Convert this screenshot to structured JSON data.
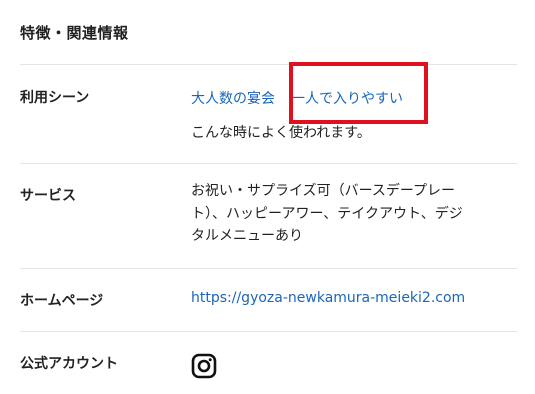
{
  "section": {
    "title": "特徴・関連情報"
  },
  "rows": {
    "scene": {
      "label": "利用シーン",
      "links": [
        "大人数の宴会",
        "一人で入りやすい"
      ],
      "note": "こんな時によく使われます。"
    },
    "service": {
      "label": "サービス",
      "lines": [
        "お祝い・サプライズ可（バースデープレー",
        "ト）、ハッピーアワー、テイクアウト、デジ",
        "タルメニューあり"
      ]
    },
    "homepage": {
      "label": "ホームページ",
      "url": "https://gyoza-newkamura-meieki2.com"
    },
    "official_account": {
      "label": "公式アカウント",
      "icon": "instagram-icon"
    }
  },
  "colors": {
    "link": "#1a66b8",
    "highlight": "#e0101e",
    "divider": "#e5e5e5",
    "text": "#222222"
  }
}
